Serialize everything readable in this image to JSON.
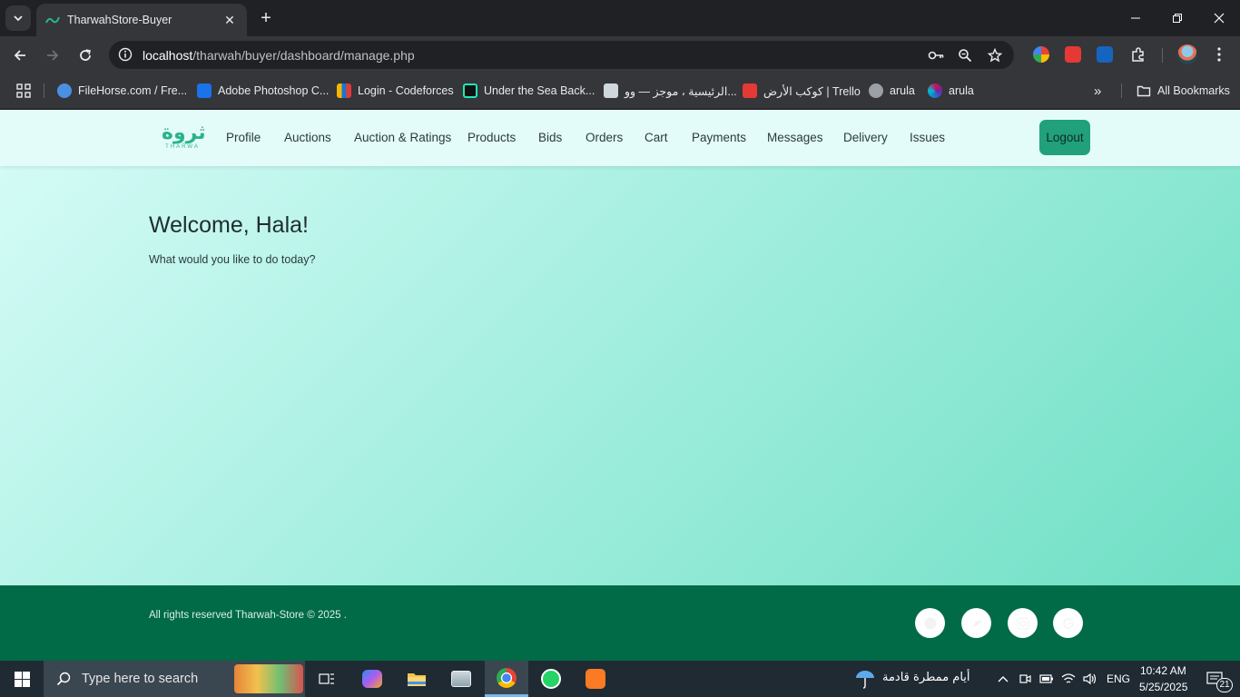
{
  "browser": {
    "tab_title": "TharwahStore-Buyer",
    "tab_close": "✕",
    "new_tab": "+",
    "url_host": "localhost",
    "url_path": "/tharwah/buyer/dashboard/manage.php",
    "bookmarks": [
      {
        "label": "FileHorse.com / Fre...",
        "icon": "filehorse-icon",
        "color": "#4a90e2"
      },
      {
        "label": "Adobe Photoshop C...",
        "icon": "link-icon",
        "color": "#1a73e8"
      },
      {
        "label": "Login - Codeforces",
        "icon": "codeforces-icon",
        "color": "#f5b700"
      },
      {
        "label": "Under the Sea Back...",
        "icon": "freepik-icon",
        "color": "#1de9b6"
      },
      {
        "label": "الرئيسية ، موجز — وو...",
        "icon": "page-icon",
        "color": "#cfd8dc"
      },
      {
        "label": "كوكب الأرض | Trello",
        "icon": "trello-icon",
        "color": "#e53935"
      },
      {
        "label": "arula",
        "icon": "gear-site-icon",
        "color": "#9aa0a6"
      },
      {
        "label": "arula",
        "icon": "colorful-ring-icon",
        "color": "#c2185b"
      }
    ],
    "bookmarks_overflow": "»",
    "all_bookmarks": "All Bookmarks"
  },
  "site": {
    "logo_ar": "ثروة",
    "logo_en": "THARWA",
    "nav": [
      "Profile",
      "Auctions",
      "Auction & Ratings",
      "Products",
      "Bids",
      "Orders",
      "Cart",
      "Payments",
      "Messages",
      "Delivery",
      "Issues"
    ],
    "logout": "Logout",
    "welcome": "Welcome, Hala!",
    "subtitle": "What would you like to do today?",
    "copyright": "All rights reserved Tharwah-Store © 2025 .",
    "social": [
      "facebook-icon",
      "twitter-icon",
      "instagram-icon",
      "google-icon"
    ],
    "colors": {
      "accent": "#21a07c",
      "footer": "#006b46",
      "nav_bg": "#e3fcfa"
    }
  },
  "taskbar": {
    "search_placeholder": "Type here to search",
    "weather": "أيام ممطرة قادمة",
    "lang": "ENG",
    "time": "10:42 AM",
    "date": "5/25/2025",
    "notifications": "21"
  }
}
